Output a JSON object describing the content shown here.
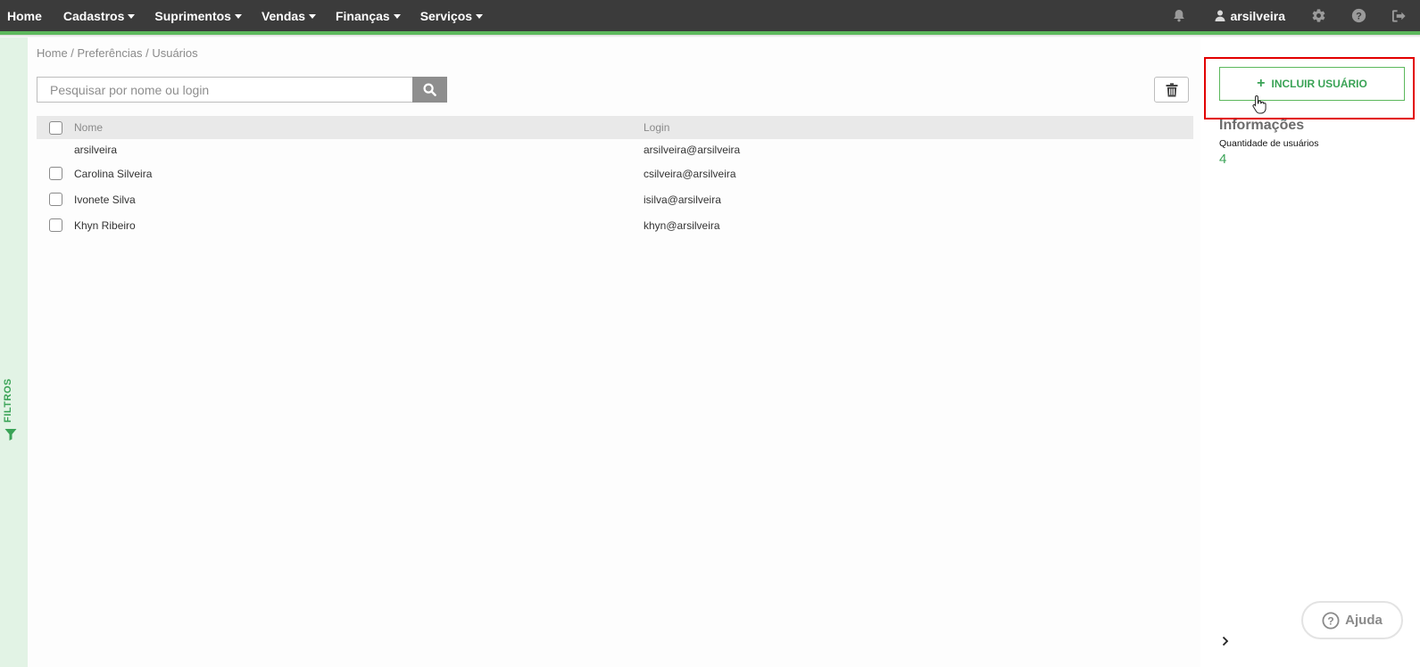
{
  "nav": {
    "items": [
      {
        "label": "Home",
        "has_dropdown": false
      },
      {
        "label": "Cadastros",
        "has_dropdown": true
      },
      {
        "label": "Suprimentos",
        "has_dropdown": true
      },
      {
        "label": "Vendas",
        "has_dropdown": true
      },
      {
        "label": "Finanças",
        "has_dropdown": true
      },
      {
        "label": "Serviços",
        "has_dropdown": true
      }
    ],
    "username": "arsilveira",
    "icons": [
      "bell-icon",
      "user-icon",
      "gear-icon",
      "help-icon",
      "logout-icon"
    ]
  },
  "filters": {
    "label": "FILTROS",
    "icon": "filter-icon"
  },
  "breadcrumb": "Home / Preferências / Usuários",
  "search": {
    "placeholder": "Pesquisar por nome ou login",
    "value": ""
  },
  "table": {
    "headers": {
      "name": "Nome",
      "login": "Login"
    },
    "rows": [
      {
        "name": "arsilveira",
        "login": "arsilveira@arsilveira",
        "has_checkbox": false
      },
      {
        "name": "Carolina Silveira",
        "login": "csilveira@arsilveira",
        "has_checkbox": true
      },
      {
        "name": "Ivonete Silva",
        "login": "isilva@arsilveira",
        "has_checkbox": true
      },
      {
        "name": "Khyn Ribeiro",
        "login": "khyn@arsilveira",
        "has_checkbox": true
      }
    ]
  },
  "sidebar": {
    "add_button_label": "INCLUIR USUÁRIO",
    "info_title": "Informações",
    "user_count_label": "Quantidade de usuários",
    "user_count": "4"
  },
  "help": {
    "label": "Ajuda"
  },
  "colors": {
    "topbar": "#3b3b3b",
    "accent": "#5cb85c",
    "accent_text": "#3aa356",
    "highlight": "#e20000"
  }
}
